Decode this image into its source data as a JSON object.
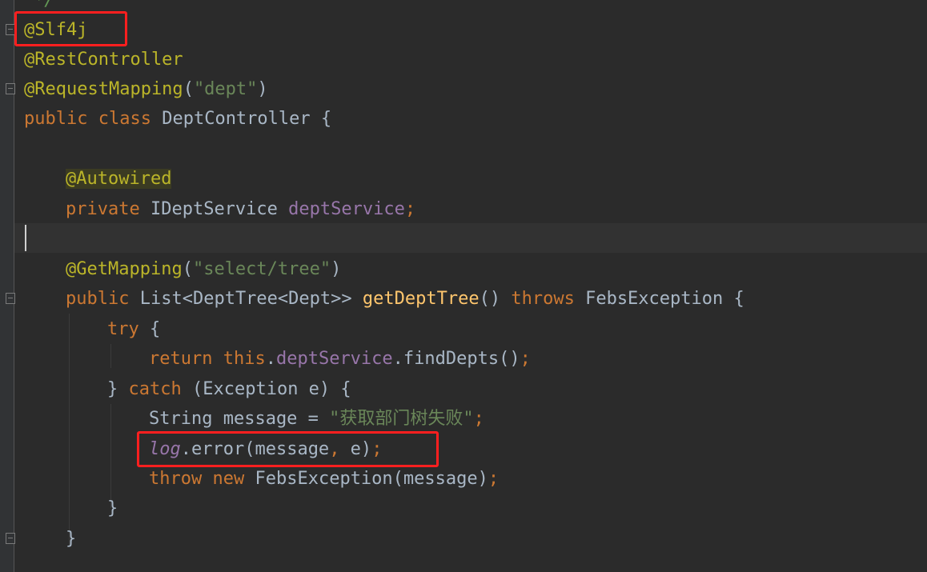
{
  "editor": {
    "colors": {
      "background": "#2b2b2b",
      "annotation": "#bbb529",
      "keyword": "#cc7832",
      "string": "#6a8759",
      "field": "#9876aa",
      "method": "#ffc66d",
      "text": "#a9b7c6",
      "highlight_box": "#ff1f1f"
    },
    "lines": {
      "l0": {
        "comment": "*/"
      },
      "l1": {
        "annotation": "@Slf4j"
      },
      "l2": {
        "annotation": "@RestController"
      },
      "l3": {
        "annotation": "@RequestMapping",
        "open": "(",
        "string": "\"dept\"",
        "close": ")"
      },
      "l4": {
        "kw1": "public",
        "kw2": "class",
        "name": "DeptController",
        "brace": "{"
      },
      "l5": {
        "annotation": "@Autowired"
      },
      "l6": {
        "kw": "private",
        "type": "IDeptService",
        "field": "deptService",
        "semi": ";"
      },
      "l7": {
        "annotation": "@GetMapping",
        "open": "(",
        "string": "\"select/tree\"",
        "close": ")"
      },
      "l8": {
        "kw": "public",
        "type": "List<DeptTree<Dept>>",
        "method": "getDeptTree",
        "parens": "()",
        "throws": "throws",
        "exc": "FebsException",
        "brace": "{"
      },
      "l9": {
        "kw": "try",
        "brace": "{"
      },
      "l10": {
        "kw": "return",
        "this": "this",
        "dot1": ".",
        "field": "deptService",
        "call": ".findDepts()",
        "semi": ";"
      },
      "l11": {
        "close": "}",
        "kw": "catch",
        "params": "(Exception e)",
        "brace": "{"
      },
      "l12": {
        "decl": "String message = ",
        "string": "\"获取部门树失败\"",
        "semi": ";"
      },
      "l13": {
        "log": "log",
        "call": ".error(message",
        "comma": ",",
        "rest": " e)",
        "semi": ";"
      },
      "l14": {
        "kw1": "throw",
        "kw2": "new",
        "call": "FebsException(message)",
        "semi": ";"
      },
      "l15": {
        "brace": "}"
      },
      "l16": {
        "brace": "}"
      }
    }
  }
}
